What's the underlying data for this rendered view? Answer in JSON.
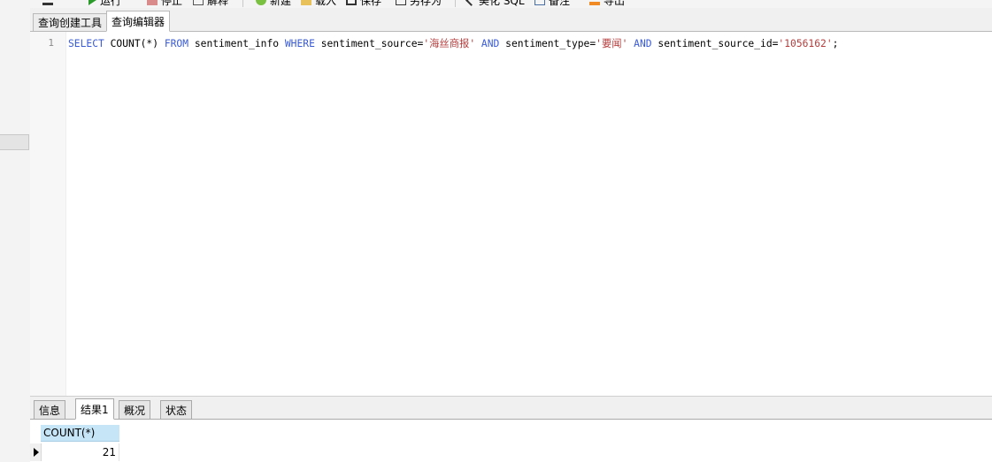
{
  "toolbar": {
    "items": [
      {
        "label": "运行",
        "icon": "play-icon"
      },
      {
        "label": "停止",
        "icon": "stop-icon"
      },
      {
        "label": "解释",
        "icon": "explain-icon"
      },
      {
        "label": "新建",
        "icon": "new-icon"
      },
      {
        "label": "载入",
        "icon": "folder-icon"
      },
      {
        "label": "保存",
        "icon": "save-icon"
      },
      {
        "label": "另存为",
        "icon": "save-as-icon"
      },
      {
        "label": "美化 SQL",
        "icon": "beautify-icon"
      },
      {
        "label": "备注",
        "icon": "note-icon"
      },
      {
        "label": "导出",
        "icon": "export-icon"
      }
    ]
  },
  "editor_tabs": [
    {
      "label": "查询创建工具"
    },
    {
      "label": "查询编辑器",
      "active": true
    }
  ],
  "editor": {
    "line_number": "1",
    "tokens": {
      "select": "SELECT",
      "count": " COUNT(*) ",
      "from": "FROM",
      "table": " sentiment_info ",
      "where": "WHERE",
      "col1": " sentiment_source=",
      "val1": "'海丝商报'",
      "and1": " AND",
      "col2": " sentiment_type=",
      "val2": "'要闻'",
      "and2": " AND",
      "col3": " sentiment_source_id=",
      "val3": "'1056162'",
      "end": ";"
    }
  },
  "result_tabs": [
    {
      "label": "信息"
    },
    {
      "label": "结果1",
      "active": true
    },
    {
      "label": "概况"
    },
    {
      "label": "状态"
    }
  ],
  "result_grid": {
    "column": "COUNT(*)",
    "rows": [
      "21"
    ]
  },
  "colors": {
    "keyword": "#3a5bd6",
    "string": "#b53d3d",
    "header_bg": "#c6e5f7"
  }
}
